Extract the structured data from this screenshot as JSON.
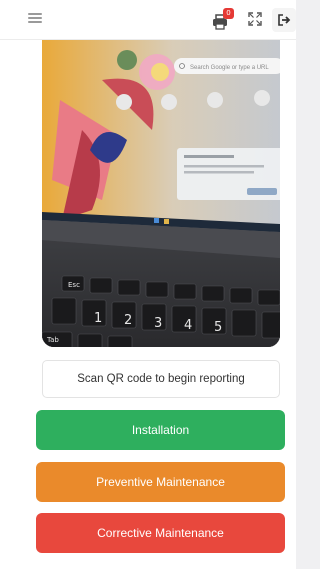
{
  "header": {
    "menu_icon": "hamburger-menu-icon",
    "print_icon": "printer-icon",
    "print_badge": "0",
    "expand_icon": "fullscreen-icon",
    "logout_icon": "logout-icon"
  },
  "scanner": {
    "prompt": "Scan QR code to begin reporting",
    "camera_screen_search_placeholder": "Search Google or type a URL"
  },
  "actions": {
    "installation": "Installation",
    "preventive": "Preventive Maintenance",
    "corrective": "Corrective Maintenance"
  },
  "colors": {
    "installation": "#2eaf5e",
    "preventive": "#ea8a2b",
    "corrective": "#e8483d",
    "badge": "#e53935"
  }
}
